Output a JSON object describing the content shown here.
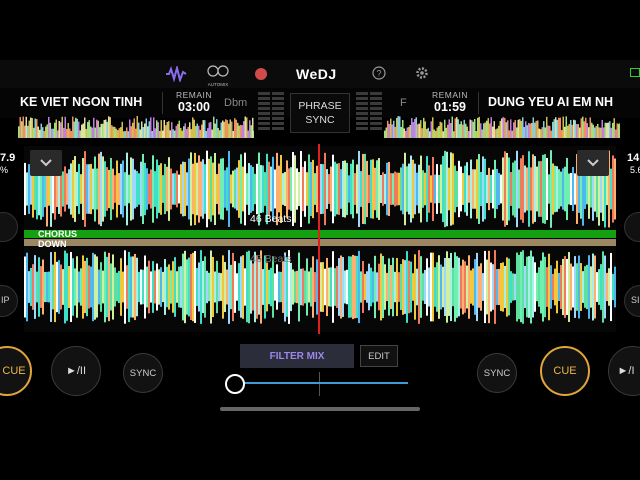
{
  "app": {
    "name": "WeDJ"
  },
  "topbar": {
    "waveform_icon": "waveform-icon",
    "automix_label": "AUTOMIX",
    "record_icon": "record-icon",
    "help_icon": "help-icon",
    "settings_icon": "gear-icon",
    "battery_icon": "battery-icon"
  },
  "deck_left": {
    "title": "KE VIET NGON TINH",
    "remain_label": "REMAIN",
    "remain_time": "03:00",
    "key": "Dbm",
    "bpm_partial": "7.9",
    "pct_partial": "%",
    "cue_label": "CUE",
    "play_label": "►/II",
    "sync_label": "SYNC",
    "side_btn_label": "IP",
    "waveform_beats": "46 Beats"
  },
  "deck_right": {
    "title": "DUNG YEU AI EM NH",
    "remain_label": "REMAIN",
    "remain_time": "01:59",
    "key": "F",
    "bpm_partial": "14",
    "pct_partial": "5.6",
    "cue_label": "CUE",
    "play_label": "►/I",
    "sync_label": "SYNC",
    "side_btn_label": "SI",
    "waveform_beats": "46 Beats"
  },
  "center": {
    "phrase_sync_line1": "PHRASE",
    "phrase_sync_line2": "SYNC",
    "filter_mix_label": "FILTER MIX",
    "edit_label": "EDIT",
    "crossfader_position": 0.0
  },
  "phrase_labels": {
    "chorus": "CHORUS",
    "down": "DOWN"
  },
  "colors": {
    "accent_cue": "#e2a53a",
    "filter_mix_text": "#9b88e8",
    "crossfader": "#3d9bd6",
    "playhead": "#e0201e",
    "phrase_chorus": "#14a010",
    "phrase_down": "#9c8763"
  }
}
